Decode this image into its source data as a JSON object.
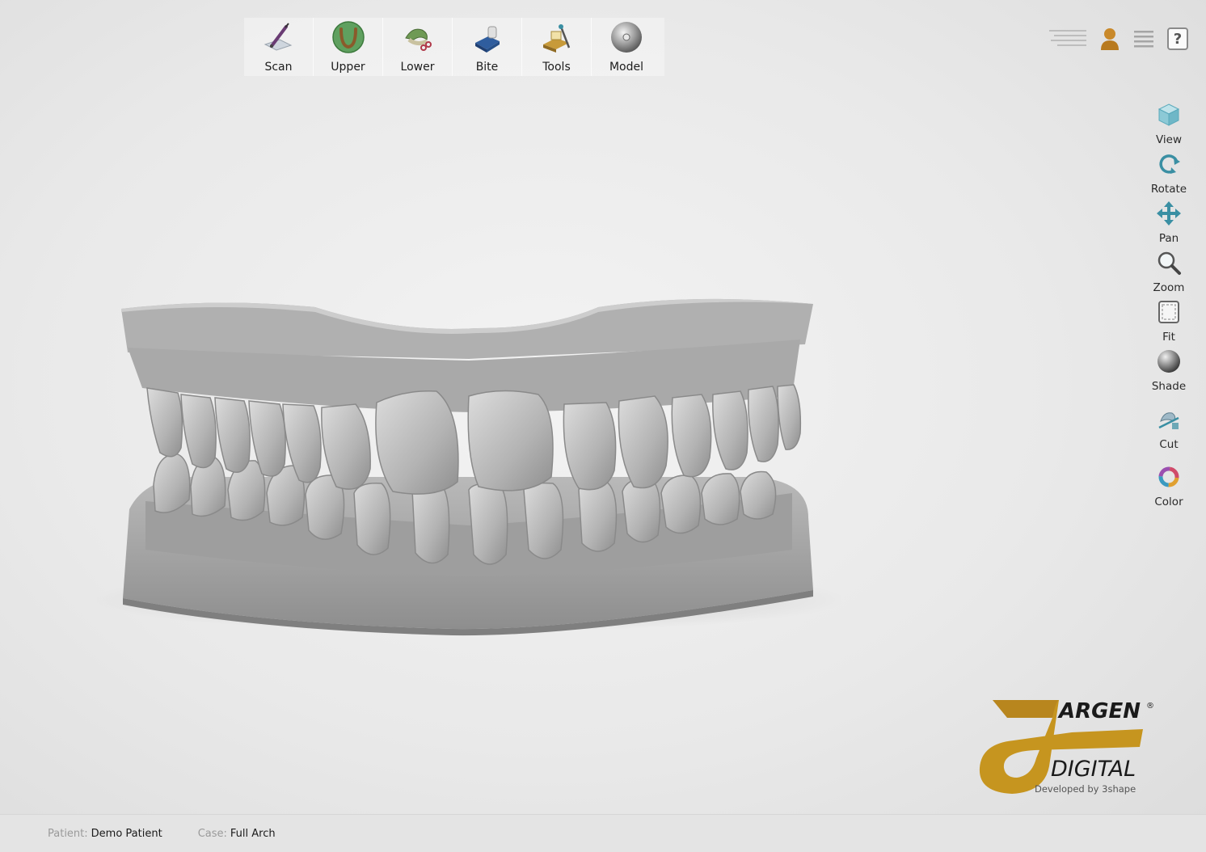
{
  "toolbar": {
    "items": [
      {
        "label": "Scan",
        "icon": "scan-pen-icon"
      },
      {
        "label": "Upper",
        "icon": "upper-arch-icon"
      },
      {
        "label": "Lower",
        "icon": "lower-arch-icon"
      },
      {
        "label": "Bite",
        "icon": "bite-block-icon"
      },
      {
        "label": "Tools",
        "icon": "tools-icon"
      },
      {
        "label": "Model",
        "icon": "model-disc-icon"
      }
    ]
  },
  "topright": {
    "icons": [
      "slider-lines-icon",
      "user-icon",
      "menu-icon",
      "help-icon"
    ],
    "help_label": "?"
  },
  "sidebar": {
    "items": [
      {
        "label": "View",
        "icon": "view-cube-icon"
      },
      {
        "label": "Rotate",
        "icon": "rotate-icon"
      },
      {
        "label": "Pan",
        "icon": "pan-arrows-icon"
      },
      {
        "label": "Zoom",
        "icon": "zoom-magnifier-icon"
      },
      {
        "label": "Fit",
        "icon": "fit-frame-icon"
      },
      {
        "label": "Shade",
        "icon": "shade-sphere-icon"
      },
      {
        "label": "Cut",
        "icon": "cut-icon"
      },
      {
        "label": "Color",
        "icon": "color-ring-icon"
      }
    ]
  },
  "logo": {
    "brand": "ARGEN",
    "product": "DIGITAL",
    "developer": "Developed by 3shape",
    "registered": "®"
  },
  "status": {
    "patient_label": "Patient:",
    "patient_value": "Demo Patient",
    "case_label": "Case:",
    "case_value": "Full Arch"
  },
  "colors": {
    "background": "#ececec",
    "accent_teal": "#3a8fa3",
    "logo_gold": "#b8861e",
    "upper_green": "#5fa05f"
  }
}
